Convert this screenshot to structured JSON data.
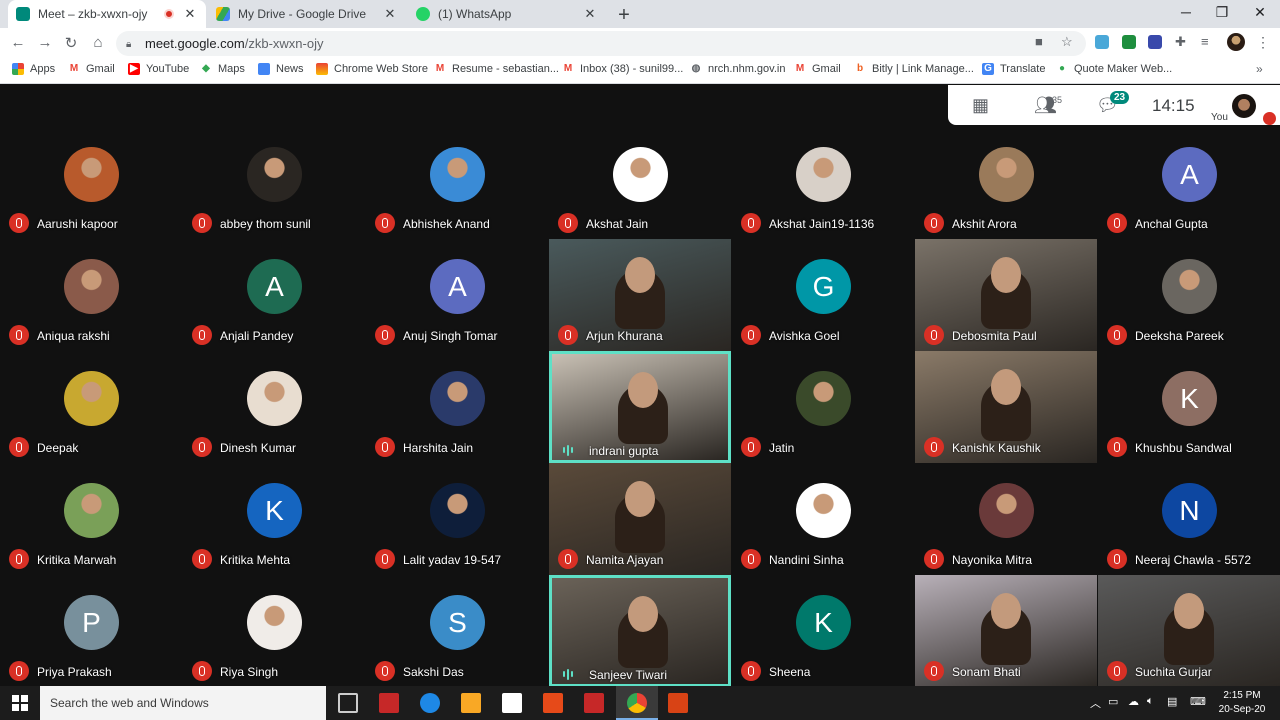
{
  "browser": {
    "tabs": [
      {
        "title": "Meet – zkb-xwxn-ojy",
        "recording": true,
        "favicon_color": "#00897b"
      },
      {
        "title": "My Drive - Google Drive",
        "favicon_color": "#fbbc04"
      },
      {
        "title": "(1) WhatsApp",
        "favicon_color": "#25d366"
      }
    ],
    "new_tab": "+",
    "url_host": "meet.google.com",
    "url_path": "/zkb-xwxn-ojy",
    "bookmarks": [
      "Apps",
      "Gmail",
      "YouTube",
      "Maps",
      "News",
      "Chrome Web Store",
      "Resume - sebastian...",
      "Inbox (38) - sunil99...",
      "nrch.nhm.gov.in",
      "Gmail",
      "Bitly | Link Manage...",
      "Translate",
      "Quote Maker Web..."
    ],
    "bookmarks_more": "»"
  },
  "meet": {
    "participants_count": "35",
    "chat_badge": "23",
    "time": "14:15",
    "you_label": "You",
    "tiles": [
      {
        "name": "Aarushi kapoor",
        "kind": "photo",
        "color": "#b85a2c"
      },
      {
        "name": "abbey thom sunil",
        "kind": "photo",
        "color": "#2a2622"
      },
      {
        "name": "Abhishek Anand",
        "kind": "photo",
        "color": "#3a8bd6"
      },
      {
        "name": "Akshat Jain",
        "kind": "photo",
        "color": "#ffffff"
      },
      {
        "name": "Akshat Jain19-1136",
        "kind": "photo",
        "color": "#d8d0c8"
      },
      {
        "name": "Akshit Arora",
        "kind": "photo",
        "color": "#9a7a5a"
      },
      {
        "name": "Anchal Gupta",
        "kind": "letter",
        "letter": "A",
        "color": "#5c6bc0"
      },
      {
        "name": "Aniqua rakshi",
        "kind": "photo",
        "color": "#8a5a4a"
      },
      {
        "name": "Anjali Pandey",
        "kind": "letter",
        "letter": "A",
        "color": "#1e6b52"
      },
      {
        "name": "Anuj Singh Tomar",
        "kind": "letter",
        "letter": "A",
        "color": "#5c6bc0"
      },
      {
        "name": "Arjun Khurana",
        "kind": "video",
        "color": "#4a5a5c"
      },
      {
        "name": "Avishka Goel",
        "kind": "letter",
        "letter": "G",
        "color": "#0097a7"
      },
      {
        "name": "Debosmita Paul",
        "kind": "video",
        "color": "#7a7268"
      },
      {
        "name": "Deeksha Pareek",
        "kind": "photo",
        "color": "#6a6660"
      },
      {
        "name": "Deepak",
        "kind": "photo",
        "color": "#c8a830"
      },
      {
        "name": "Dinesh Kumar",
        "kind": "photo",
        "color": "#e8ddd0"
      },
      {
        "name": "Harshita Jain",
        "kind": "photo",
        "color": "#2a3a6a"
      },
      {
        "name": "indrani gupta",
        "kind": "video",
        "color": "#c8c0b4",
        "speaking": true
      },
      {
        "name": "Jatin",
        "kind": "photo",
        "color": "#3a4a2a"
      },
      {
        "name": "Kanishk Kaushik",
        "kind": "video",
        "color": "#8a7a68"
      },
      {
        "name": "Khushbu Sandwal",
        "kind": "letter",
        "letter": "K",
        "color": "#8d6e63"
      },
      {
        "name": "Kritika Marwah",
        "kind": "photo",
        "color": "#7aa058"
      },
      {
        "name": "Kritika Mehta",
        "kind": "letter",
        "letter": "K",
        "color": "#1565c0"
      },
      {
        "name": "Lalit yadav 19-547",
        "kind": "photo",
        "color": "#0e1e3a"
      },
      {
        "name": "Namita Ajayan",
        "kind": "video",
        "color": "#5a4a3a"
      },
      {
        "name": "Nandini Sinha",
        "kind": "photo",
        "color": "#ffffff"
      },
      {
        "name": "Nayonika Mitra",
        "kind": "photo",
        "color": "#6a3a3a"
      },
      {
        "name": "Neeraj Chawla - 5572",
        "kind": "letter",
        "letter": "N",
        "color": "#0d47a1"
      },
      {
        "name": "Priya Prakash",
        "kind": "letter",
        "letter": "P",
        "color": "#78909c"
      },
      {
        "name": "Riya Singh",
        "kind": "photo",
        "color": "#f0ece8"
      },
      {
        "name": "Sakshi Das",
        "kind": "letter",
        "letter": "S",
        "color": "#3a8cc8"
      },
      {
        "name": "Sanjeev Tiwari",
        "kind": "video",
        "color": "#6a6258",
        "speaking": true
      },
      {
        "name": "Sheena",
        "kind": "letter",
        "letter": "K",
        "color": "#00796b"
      },
      {
        "name": "Sonam Bhati",
        "kind": "video",
        "color": "#b8b0b8"
      },
      {
        "name": "Suchita Gurjar",
        "kind": "video",
        "color": "#5a5a5a"
      }
    ]
  },
  "taskbar": {
    "search_placeholder": "Search the web and Windows",
    "time": "2:15 PM",
    "date": "20-Sep-20"
  }
}
